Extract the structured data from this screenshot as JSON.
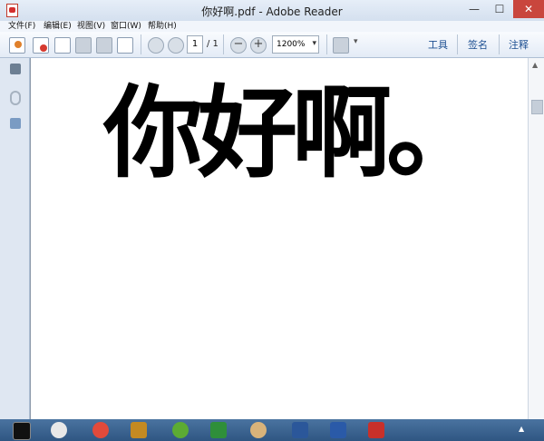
{
  "window": {
    "title": "你好啊.pdf - Adobe Reader"
  },
  "menubar": {
    "items": [
      "文件(F)",
      "编辑(E)",
      "视图(V)",
      "窗口(W)",
      "帮助(H)"
    ]
  },
  "toolbar": {
    "page_current": "1",
    "page_total": "/ 1",
    "zoom": "1200%",
    "zoom_out_symbol": "−",
    "zoom_in_symbol": "+",
    "right_tabs": [
      "工具",
      "签名",
      "注释"
    ]
  },
  "window_controls": {
    "minimize": "—",
    "maximize": "☐",
    "close": "✕"
  },
  "document": {
    "text": "你好啊。"
  },
  "scrollbar": {
    "up_arrow": "▲"
  },
  "taskbar": {
    "apps": [
      "cmd",
      "talk",
      "weibo",
      "game",
      "browser",
      "vim",
      "paint",
      "word-blue",
      "word",
      "acrobat"
    ],
    "tray_arrow": "▲"
  },
  "colors": {
    "close_button": "#c9463d",
    "taskbar": "#3a6290",
    "accent_text": "#1d4f91"
  }
}
